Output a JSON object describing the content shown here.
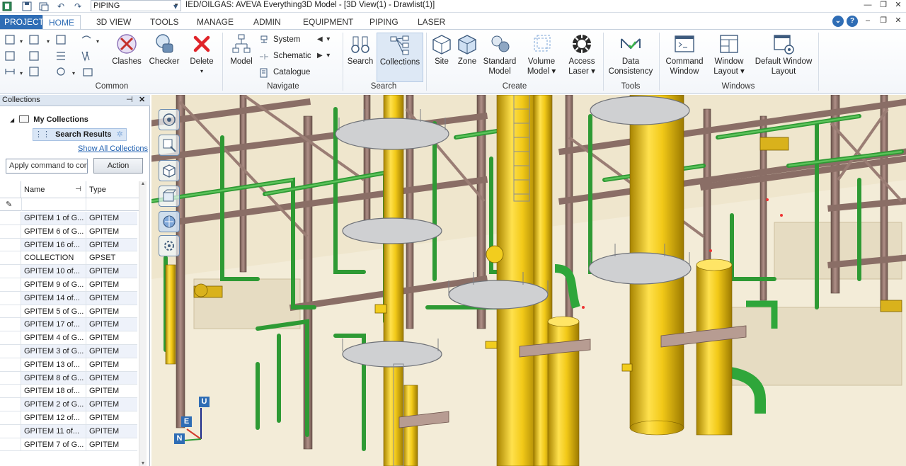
{
  "titlebar": {
    "module": "PIPING",
    "title": "IED/OILGAS: AVEVA Everything3D Model - [3D View(1) - Drawlist(1)]"
  },
  "tabs": [
    "PROJECT",
    "HOME",
    "3D VIEW",
    "TOOLS",
    "MANAGE",
    "ADMIN",
    "EQUIPMENT",
    "PIPING",
    "LASER"
  ],
  "active_tab": "HOME",
  "ribbon": {
    "groups": {
      "common": "Common",
      "navigate": "Navigate",
      "search": "Search",
      "create": "Create",
      "tools": "Tools",
      "windows": "Windows"
    },
    "common_buttons": [
      {
        "label": "Clashes"
      },
      {
        "label": "Checker"
      },
      {
        "label": "Delete"
      }
    ],
    "model_label": "Model",
    "navigate_items": [
      "System",
      "Schematic",
      "Catalogue"
    ],
    "search_buttons": [
      {
        "label": "Search"
      },
      {
        "label": "Collections"
      }
    ],
    "create_buttons": [
      {
        "label": "Site",
        "label2": ""
      },
      {
        "label": "Zone",
        "label2": ""
      },
      {
        "label": "Standard",
        "label2": "Model"
      },
      {
        "label": "Volume",
        "label2": "Model ▾"
      },
      {
        "label": "Access",
        "label2": "Laser ▾"
      }
    ],
    "tools_buttons": [
      {
        "label": "Data",
        "label2": "Consistency"
      }
    ],
    "windows_buttons": [
      {
        "label": "Command",
        "label2": "Window"
      },
      {
        "label": "Window",
        "label2": "Layout ▾"
      },
      {
        "label": "Default Window",
        "label2": "Layout"
      }
    ]
  },
  "panel": {
    "title": "Collections",
    "tree_root": "My Collections",
    "tree_child": "Search Results",
    "show_all": "Show All Collections",
    "command_value": "Apply command to con",
    "action_label": "Action",
    "columns": [
      "Name",
      "Type"
    ],
    "rows": [
      {
        "name": "GPITEM 1 of G...",
        "type": "GPITEM"
      },
      {
        "name": "GPITEM 6 of G...",
        "type": "GPITEM"
      },
      {
        "name": "GPITEM 16 of...",
        "type": "GPITEM"
      },
      {
        "name": "COLLECTION",
        "type": "GPSET"
      },
      {
        "name": "GPITEM 10 of...",
        "type": "GPITEM"
      },
      {
        "name": "GPITEM 9 of G...",
        "type": "GPITEM"
      },
      {
        "name": "GPITEM 14 of...",
        "type": "GPITEM"
      },
      {
        "name": "GPITEM 5 of G...",
        "type": "GPITEM"
      },
      {
        "name": "GPITEM 17 of...",
        "type": "GPITEM"
      },
      {
        "name": "GPITEM 4 of G...",
        "type": "GPITEM"
      },
      {
        "name": "GPITEM 3 of G...",
        "type": "GPITEM"
      },
      {
        "name": "GPITEM 13 of...",
        "type": "GPITEM"
      },
      {
        "name": "GPITEM 8 of G...",
        "type": "GPITEM"
      },
      {
        "name": "GPITEM 18 of...",
        "type": "GPITEM"
      },
      {
        "name": "GPITEM 2 of G...",
        "type": "GPITEM"
      },
      {
        "name": "GPITEM 12 of...",
        "type": "GPITEM"
      },
      {
        "name": "GPITEM 11 of...",
        "type": "GPITEM"
      },
      {
        "name": "GPITEM 7 of G...",
        "type": "GPITEM"
      }
    ]
  },
  "axes": {
    "up": "U",
    "east": "E",
    "north": "N"
  },
  "colors": {
    "accent": "#2f6db5",
    "vessel_yellow": "#e8c21a",
    "pipe_green": "#35a83a",
    "steel": "#9a7d74",
    "ground": "#efe7cf"
  }
}
